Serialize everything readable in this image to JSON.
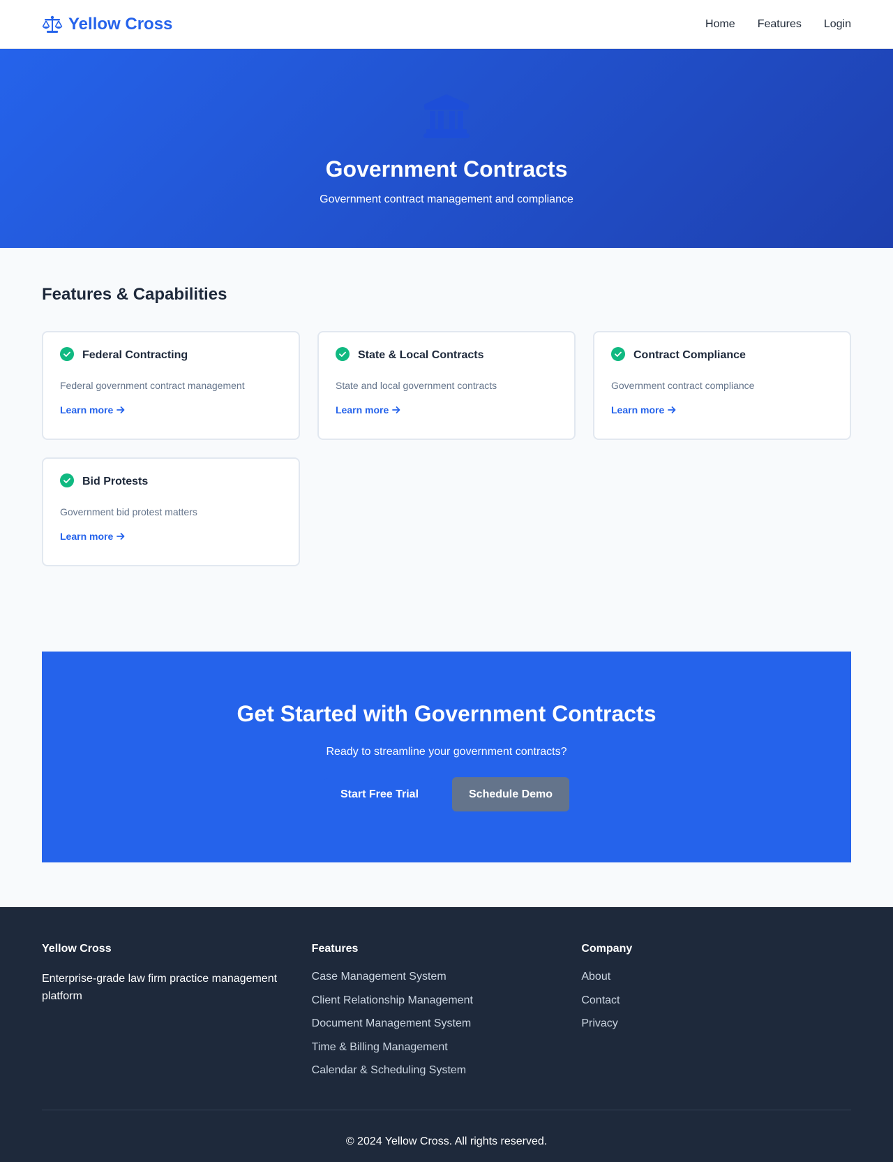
{
  "nav": {
    "brand": "Yellow Cross",
    "brand_icon": "scale-balance-icon",
    "links": [
      "Home",
      "Features",
      "Login"
    ]
  },
  "hero": {
    "icon": "landmark-icon",
    "title": "Government Contracts",
    "subtitle": "Government contract management and compliance"
  },
  "features": {
    "title": "Features & Capabilities",
    "cards": [
      {
        "title": "Federal Contracting",
        "description": "Federal government contract management",
        "link": "Learn more"
      },
      {
        "title": "State & Local Contracts",
        "description": "State and local government contracts",
        "link": "Learn more"
      },
      {
        "title": "Contract Compliance",
        "description": "Government contract compliance",
        "link": "Learn more"
      },
      {
        "title": "Bid Protests",
        "description": "Government bid protest matters",
        "link": "Learn more"
      }
    ]
  },
  "cta": {
    "title": "Get Started with Government Contracts",
    "text": "Ready to streamline your government contracts?",
    "primary_button": "Start Free Trial",
    "secondary_button": "Schedule Demo"
  },
  "footer": {
    "brand_heading": "Yellow Cross",
    "brand_description": "Enterprise-grade law firm practice management platform",
    "features_heading": "Features",
    "features_links": [
      "Case Management System",
      "Client Relationship Management",
      "Document Management System",
      "Time & Billing Management",
      "Calendar & Scheduling System"
    ],
    "company_heading": "Company",
    "company_links": [
      "About",
      "Contact",
      "Privacy"
    ],
    "copyright": "© 2024 Yellow Cross. All rights reserved."
  },
  "colors": {
    "primary": "#2563eb",
    "hero_gradient_end": "#1e40af",
    "success": "#10b981",
    "footer_bg": "#1e293b",
    "secondary_button": "#64748b"
  }
}
